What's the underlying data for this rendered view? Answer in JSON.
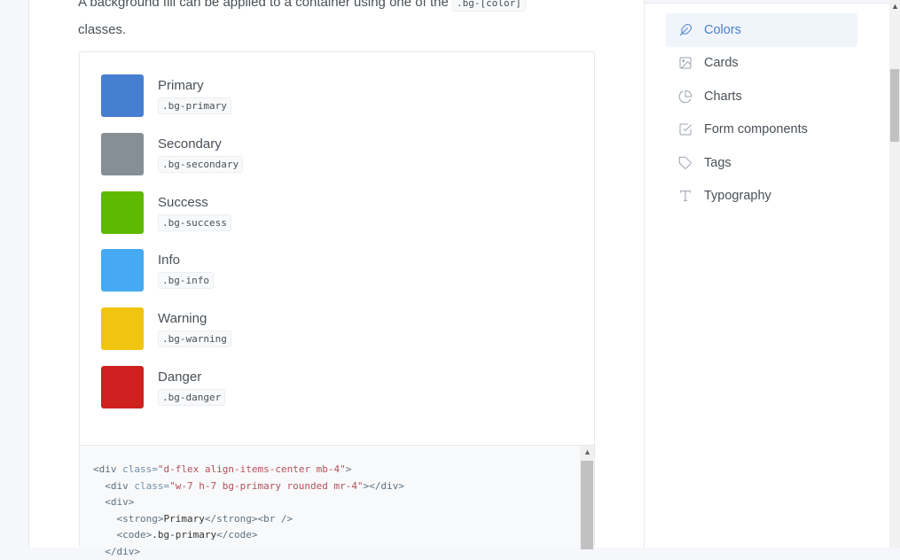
{
  "intro": {
    "before": "A background fill can be applied to a container using one of the ",
    "code": ".bg-[color]",
    "after": " classes."
  },
  "swatches": [
    {
      "name": "Primary",
      "class": ".bg-primary",
      "color": "#467fcf"
    },
    {
      "name": "Secondary",
      "class": ".bg-secondary",
      "color": "#868e96"
    },
    {
      "name": "Success",
      "class": ".bg-success",
      "color": "#5eba00"
    },
    {
      "name": "Info",
      "class": ".bg-info",
      "color": "#45aaf2"
    },
    {
      "name": "Warning",
      "class": ".bg-warning",
      "color": "#f1c40f"
    },
    {
      "name": "Danger",
      "class": ".bg-danger",
      "color": "#cd201f"
    }
  ],
  "code": {
    "l1a": "<div ",
    "l1b": "class=",
    "l1c": "\"d-flex align-items-center mb-4\"",
    "l1d": ">",
    "l2a": "  <div ",
    "l2b": "class=",
    "l2c": "\"w-7 h-7 bg-primary rounded mr-4\"",
    "l2d": "></div>",
    "l3": "  <div>",
    "l4a": "    <strong>",
    "l4b": "Primary",
    "l4c": "</strong><br />",
    "l5a": "    <code>",
    "l5b": ".bg-primary",
    "l5c": "</code>",
    "l6": "  </div>"
  },
  "nav": [
    {
      "label": "Colors",
      "icon": "feather-icon",
      "active": true
    },
    {
      "label": "Cards",
      "icon": "image-icon"
    },
    {
      "label": "Charts",
      "icon": "pie-chart-icon"
    },
    {
      "label": "Form components",
      "icon": "check-square-icon"
    },
    {
      "label": "Tags",
      "icon": "tag-icon"
    },
    {
      "label": "Typography",
      "icon": "type-icon"
    }
  ]
}
